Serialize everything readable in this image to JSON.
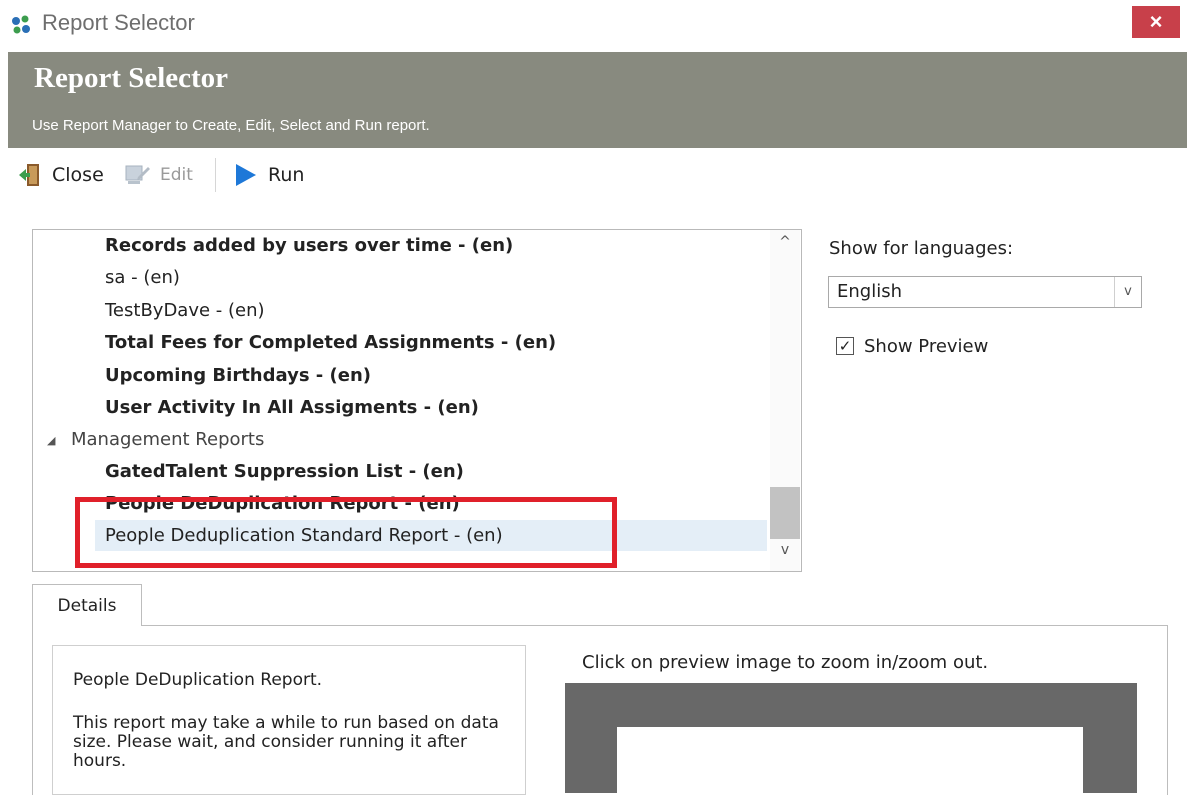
{
  "window": {
    "title": "Report Selector",
    "close_glyph": "×"
  },
  "banner": {
    "title": "Report Selector",
    "subtitle": "Use Report Manager to Create, Edit, Select and Run report."
  },
  "toolbar": {
    "close_label": "Close",
    "edit_label": "Edit",
    "run_label": "Run"
  },
  "report_list": {
    "items": [
      {
        "label": "Records added by users over time - (en)",
        "bold": true
      },
      {
        "label": "sa - (en)",
        "bold": false
      },
      {
        "label": "TestByDave - (en)",
        "bold": false
      },
      {
        "label": "Total Fees for Completed Assignments - (en)",
        "bold": true
      },
      {
        "label": "Upcoming Birthdays - (en)",
        "bold": true
      },
      {
        "label": "User Activity In All Assigments - (en)",
        "bold": true
      },
      {
        "label": "Management Reports",
        "group": true
      },
      {
        "label": "GatedTalent Suppression List - (en)",
        "bold": true
      },
      {
        "label": "People DeDuplication Report - (en)",
        "bold": true
      },
      {
        "label": "People Deduplication Standard Report - (en)",
        "bold": false,
        "selected": true
      }
    ]
  },
  "settings": {
    "languages_label": "Show for languages:",
    "language_value": "English",
    "show_preview_label": "Show Preview",
    "show_preview_checked": true
  },
  "details": {
    "tab_label": "Details",
    "report_title": "People DeDuplication Report.",
    "report_description": "This report may take a while to run based on data size. Please wait, and consider running it after hours.",
    "preview_hint": "Click on preview image to zoom in/zoom out."
  },
  "colors": {
    "banner": "#888a7f",
    "close_button": "#c8404a",
    "highlight": "#e0202a",
    "selection": "#e4eef7",
    "run_icon": "#1e78d8"
  }
}
